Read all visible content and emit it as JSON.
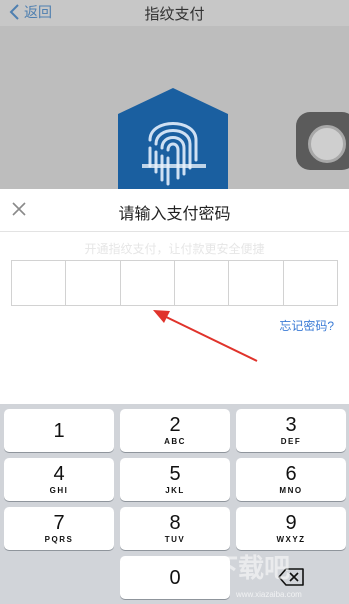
{
  "nav": {
    "back_label": "返回",
    "title": "指纹支付"
  },
  "sheet": {
    "title": "请输入支付密码",
    "ghost_text": "开通指纹支付，让付款更安全便捷",
    "pin_length": 6,
    "forgot_label": "忘记密码?"
  },
  "keypad": {
    "keys": [
      {
        "num": "1",
        "letters": ""
      },
      {
        "num": "2",
        "letters": "ABC"
      },
      {
        "num": "3",
        "letters": "DEF"
      },
      {
        "num": "4",
        "letters": "GHI"
      },
      {
        "num": "5",
        "letters": "JKL"
      },
      {
        "num": "6",
        "letters": "MNO"
      },
      {
        "num": "7",
        "letters": "PQRS"
      },
      {
        "num": "8",
        "letters": "TUV"
      },
      {
        "num": "9",
        "letters": "WXYZ"
      },
      {
        "num": "0",
        "letters": ""
      }
    ],
    "delete_icon": "backspace-icon"
  },
  "watermark": {
    "text": "下载吧",
    "url": "www.xiazaiba.com"
  },
  "colors": {
    "link": "#3b7bd5",
    "fingerprint_card": "#1a5fa0",
    "arrow": "#e0332b",
    "keypad_bg": "#d1d4d9"
  }
}
